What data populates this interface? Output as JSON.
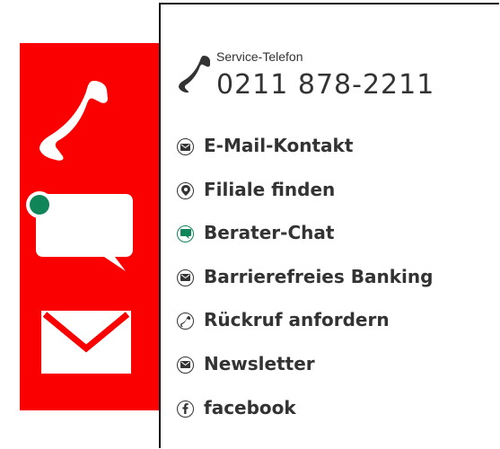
{
  "service": {
    "label": "Service-Telefon",
    "number": "0211 878-2211"
  },
  "menu": [
    {
      "label": "E-Mail-Kontakt",
      "icon": "mail-icon"
    },
    {
      "label": "Filiale finden",
      "icon": "location-pin-icon"
    },
    {
      "label": "Berater-Chat",
      "icon": "chat-icon"
    },
    {
      "label": "Barrierefreies Banking",
      "icon": "mail-icon"
    },
    {
      "label": "Rückruf anfordern",
      "icon": "phone-icon"
    },
    {
      "label": "Newsletter",
      "icon": "mail-icon"
    },
    {
      "label": "facebook",
      "icon": "facebook-icon"
    }
  ],
  "sidebar": {
    "items": [
      {
        "icon": "phone-icon"
      },
      {
        "icon": "chat-icon"
      },
      {
        "icon": "mail-icon"
      }
    ]
  },
  "colors": {
    "brand_red": "#fb0000",
    "chat_green": "#11855a",
    "text": "#333333"
  }
}
